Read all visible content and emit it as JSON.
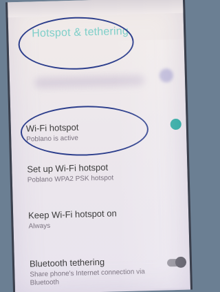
{
  "header": {
    "title": "Hotspot & tethering"
  },
  "settings": {
    "wifi_hotspot": {
      "title": "Wi-Fi hotspot",
      "subtitle": "Poblano is active",
      "toggle_state": "on"
    },
    "setup_wifi_hotspot": {
      "title": "Set up Wi-Fi hotspot",
      "subtitle": "Poblano WPA2 PSK hotspot"
    },
    "keep_wifi_hotspot_on": {
      "title": "Keep Wi-Fi hotspot on",
      "subtitle": "Always"
    },
    "bluetooth_tethering": {
      "title": "Bluetooth tethering",
      "subtitle": "Share phone's Internet connection via Bluetooth",
      "toggle_state": "off"
    }
  },
  "colors": {
    "title_accent": "#7fcfc9",
    "toggle_on": "#2aa6a0",
    "annotation_ellipse": "#2c3e8c"
  }
}
